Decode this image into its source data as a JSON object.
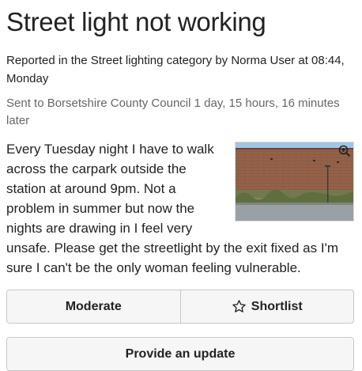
{
  "report": {
    "title": "Street light not working",
    "meta": "Reported in the Street lighting category by Norma User at 08:44, Monday",
    "sent": "Sent to Borsetshire County Council 1 day, 15 hours, 16 minutes later",
    "description": "Every Tuesday night I have to walk across the carpark outside the station at around 9pm. Not a problem in summer but now the nights are drawing in I feel very unsafe. Please get the streetlight by the exit fixed as I'm sure I can't be the only woman feeling vulnerable."
  },
  "photo": {
    "icon": "zoom-in-icon"
  },
  "actions": {
    "moderate_label": "Moderate",
    "shortlist_label": "Shortlist",
    "shortlist_icon": "star-outline-icon",
    "update_label": "Provide an update"
  }
}
